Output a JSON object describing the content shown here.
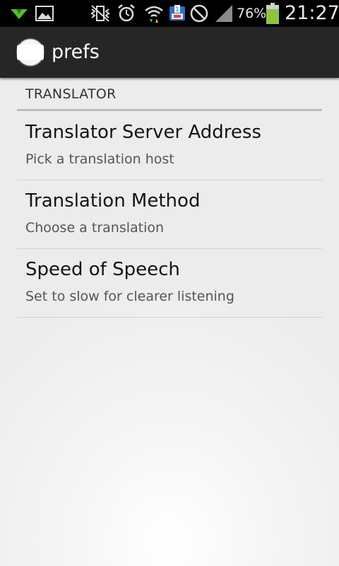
{
  "status_bar": {
    "icons": [
      "download-arrow-icon",
      "image-icon",
      "vibrate-mute-icon",
      "alarm-icon",
      "wifi-icon",
      "upload-notification-icon",
      "no-sim-icon",
      "signal-icon",
      "battery-icon"
    ],
    "battery_percent": "76%",
    "time": "21:27",
    "colors": {
      "download": "#5cb832",
      "battery": "#8cc63e",
      "wifi_up": "#f0a030",
      "wifi_down": "#5cb832"
    }
  },
  "action_bar": {
    "title": "prefs"
  },
  "preferences": {
    "category": "TRANSLATOR",
    "items": [
      {
        "title": "Translator Server Address",
        "summary": "Pick a translation host"
      },
      {
        "title": "Translation Method",
        "summary": "Choose a translation"
      },
      {
        "title": "Speed of Speech",
        "summary": "Set to slow for clearer listening"
      }
    ]
  }
}
